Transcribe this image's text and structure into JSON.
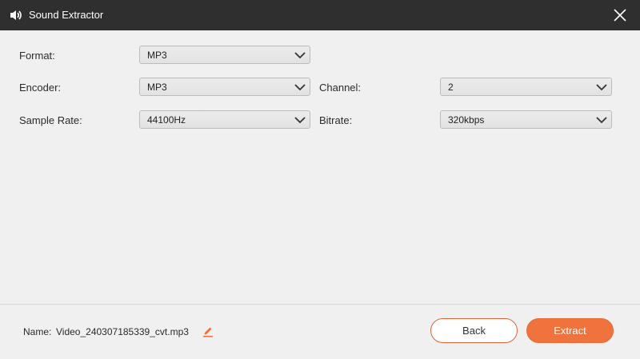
{
  "window": {
    "title": "Sound Extractor",
    "icons": {
      "app": "sound-extractor-icon",
      "close": "close-icon"
    }
  },
  "settings": {
    "format": {
      "label": "Format:",
      "value": "MP3"
    },
    "encoder": {
      "label": "Encoder:",
      "value": "MP3"
    },
    "channel": {
      "label": "Channel:",
      "value": "2"
    },
    "sample_rate": {
      "label": "Sample Rate:",
      "value": "44100Hz"
    },
    "bitrate": {
      "label": "Bitrate:",
      "value": "320kbps"
    }
  },
  "footer": {
    "name_label": "Name:",
    "file_name": "Video_240307185339_cvt.mp3",
    "back_label": "Back",
    "extract_label": "Extract"
  },
  "colors": {
    "titlebar": "#2f2f2f",
    "accent": "#f0733e",
    "background": "#f0f0f0"
  }
}
